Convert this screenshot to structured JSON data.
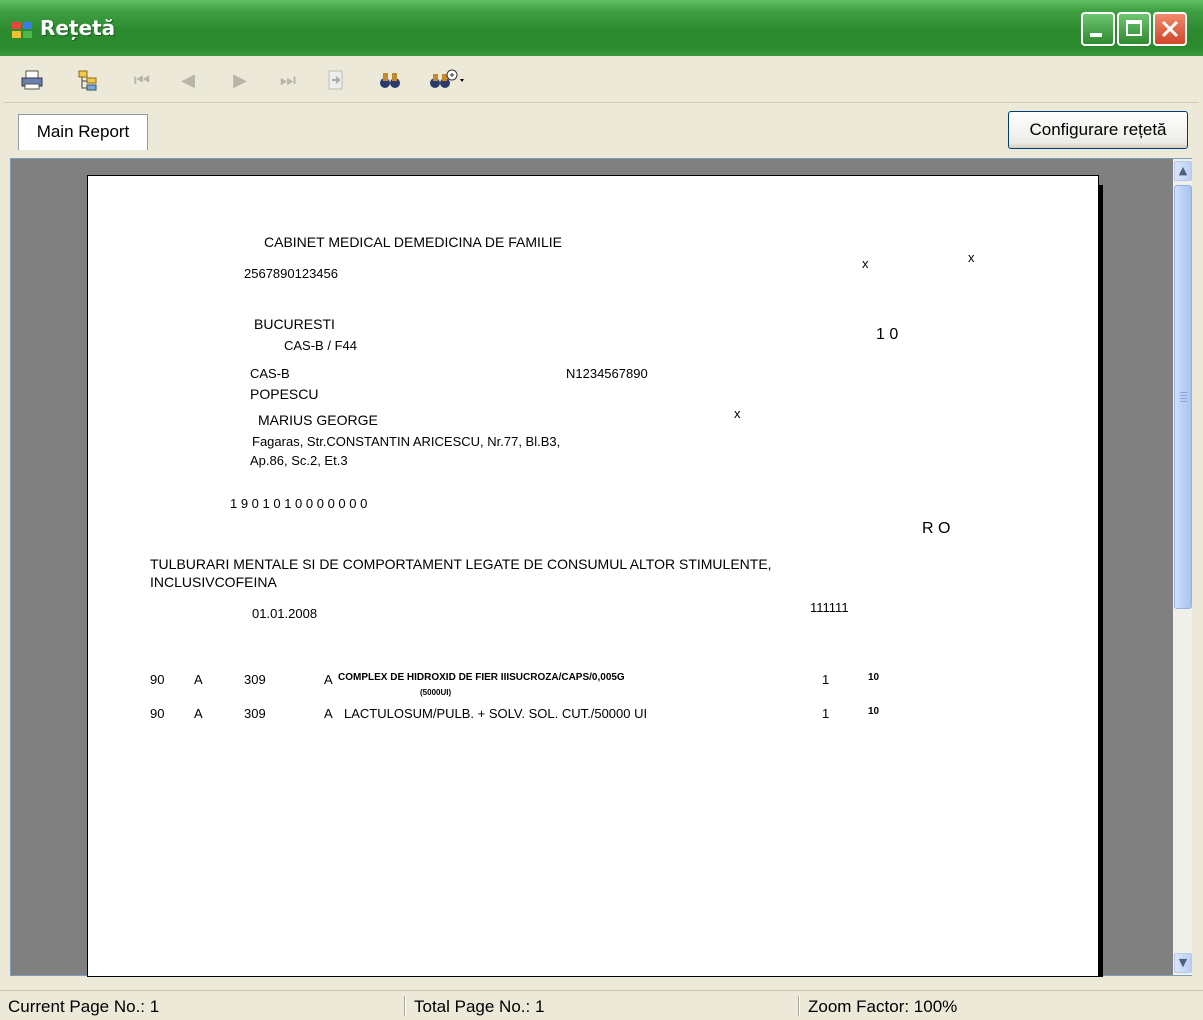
{
  "window": {
    "title": "Rețetă"
  },
  "toolbar": {
    "buttons": [
      {
        "name": "print-button",
        "icon": "printer-icon",
        "glyph": "⎙",
        "enabled": true
      },
      {
        "name": "group-tree-button",
        "icon": "tree-icon",
        "glyph": "☷",
        "enabled": true
      },
      {
        "name": "first-page-button",
        "icon": "first-page-icon",
        "glyph": "⏮",
        "enabled": false
      },
      {
        "name": "previous-page-button",
        "icon": "previous-page-icon",
        "glyph": "◂",
        "enabled": false
      },
      {
        "name": "next-page-button",
        "icon": "next-page-icon",
        "glyph": "▸",
        "enabled": false
      },
      {
        "name": "last-page-button",
        "icon": "last-page-icon",
        "glyph": "⏭",
        "enabled": false
      },
      {
        "name": "goto-page-button",
        "icon": "goto-page-icon",
        "glyph": "⇲",
        "enabled": false
      },
      {
        "name": "find-button",
        "icon": "binoculars-icon",
        "glyph": "🔍",
        "enabled": true
      },
      {
        "name": "zoom-button",
        "icon": "zoom-icon",
        "glyph": "⚲",
        "enabled": true
      }
    ]
  },
  "tabs": {
    "main_label": "Main Report"
  },
  "config_button": {
    "label": "Configurare rețetă"
  },
  "report": {
    "clinic_name": "CABINET MEDICAL DEMEDICINA DE FAMILIE",
    "clinic_code": "2567890123456",
    "x_mark_1": "x",
    "x_mark_2": "x",
    "city": "BUCURESTI",
    "cas_code": "CAS-B / F44",
    "number_right": "1 0",
    "cas": "CAS-B",
    "n_code": "N1234567890",
    "last_name": "POPESCU",
    "first_name": "MARIUS GEORGE",
    "x_mark_3": "x",
    "address_line1": "Fagaras, Str.CONSTANTIN ARICESCU, Nr.77, Bl.B3,",
    "address_line2": "Ap.86, Sc.2, Et.3",
    "cnp": "1 9 0 1 0 1 0 0 0 0 0 0 0",
    "country": "R O",
    "diagnosis_line1": "TULBURARI MENTALE SI DE COMPORTAMENT LEGATE DE CONSUMUL ALTOR STIMULENTE,",
    "diagnosis_line2": "INCLUSIVCOFEINA",
    "date": "01.01.2008",
    "code_right": "111111",
    "items": [
      {
        "c1": "90",
        "c2": "A",
        "c3": "309",
        "c4": "A",
        "name": "COMPLEX DE HIDROXID DE FIER IIISUCROZA/CAPS/0,005G",
        "name2": "(5000UI)",
        "qty": "1",
        "days": "10"
      },
      {
        "c1": "90",
        "c2": "A",
        "c3": "309",
        "c4": "A",
        "name": "LACTULOSUM/PULB. + SOLV. SOL. CUT./50000 UI",
        "name2": "",
        "qty": "1",
        "days": "10"
      }
    ]
  },
  "status": {
    "current_page": "Current Page No.: 1",
    "total_page": "Total Page No.: 1",
    "zoom": "Zoom Factor: 100%"
  }
}
